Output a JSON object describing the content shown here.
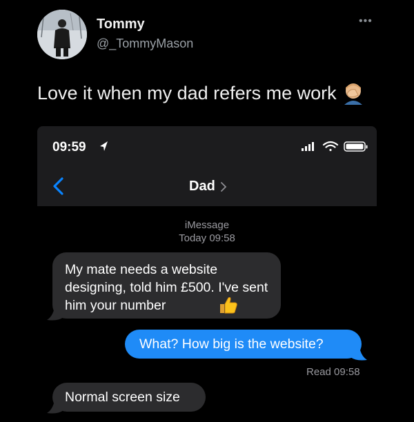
{
  "tweet": {
    "name": "Tommy",
    "handle": "@_TommyMason",
    "text": "Love it when my dad refers me work",
    "more_icon": "more-horizontal-icon",
    "emoji": "man-facepalming-emoji"
  },
  "phone": {
    "status_time": "09:59",
    "status_icons": [
      "location-arrow-icon",
      "signal-icon",
      "wifi-icon",
      "battery-icon"
    ],
    "contact_name": "Dad",
    "service": "iMessage",
    "timestamp": "Today 09:58"
  },
  "messages": [
    {
      "direction": "incoming",
      "text": "My mate needs a website designing, told him £500. I've sent him your number",
      "emoji": "thumbs-up-emoji"
    },
    {
      "direction": "outgoing",
      "text": "What? How big is the website?",
      "status": "Read 09:58"
    },
    {
      "direction": "incoming",
      "text": "Normal screen size"
    }
  ],
  "colors": {
    "background": "#000000",
    "incoming_bubble": "#2c2c2e",
    "outgoing_bubble": "#1f8bf7",
    "ios_blue": "#0a84ff",
    "header_bg": "#1c1c1e"
  }
}
